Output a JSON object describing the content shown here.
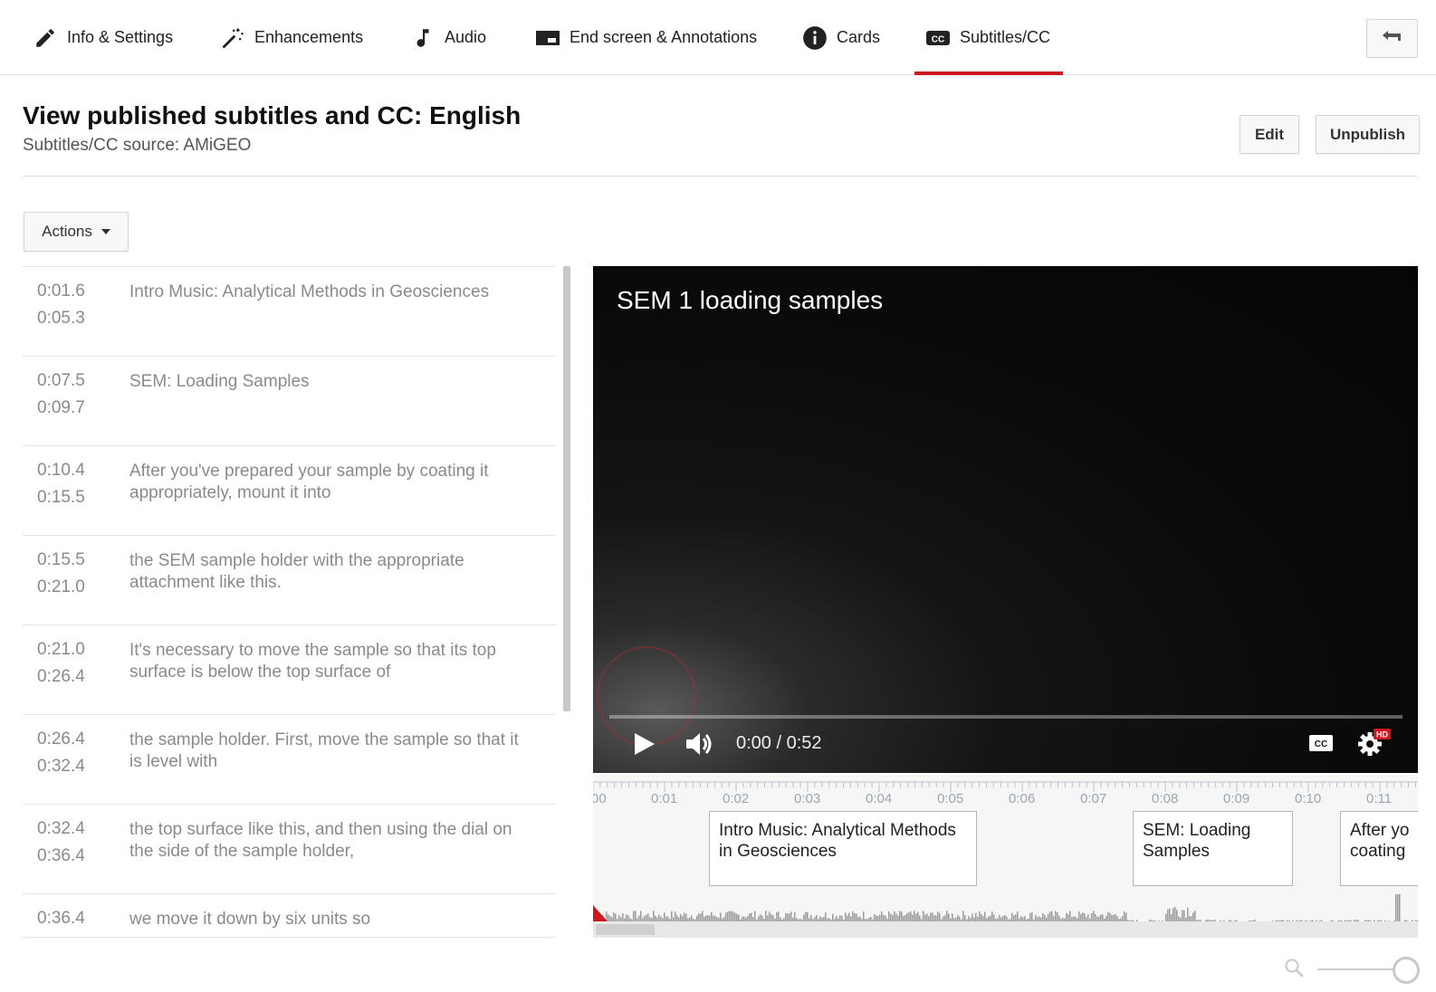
{
  "tabs": [
    {
      "label": "Info & Settings",
      "icon": "pencil-icon"
    },
    {
      "label": "Enhancements",
      "icon": "magic-wand-icon"
    },
    {
      "label": "Audio",
      "icon": "music-note-icon"
    },
    {
      "label": "End screen & Annotations",
      "icon": "end-screen-icon"
    },
    {
      "label": "Cards",
      "icon": "info-circle-icon"
    },
    {
      "label": "Subtitles/CC",
      "icon": "cc-icon",
      "active": true
    }
  ],
  "header": {
    "title": "View published subtitles and CC: English",
    "subtitle": "Subtitles/CC source: AMiGEO",
    "edit_label": "Edit",
    "unpublish_label": "Unpublish"
  },
  "actions_label": "Actions",
  "subtitles": [
    {
      "start": "0:01.6",
      "end": "0:05.3",
      "text": "Intro Music: Analytical Methods in Geosciences"
    },
    {
      "start": "0:07.5",
      "end": "0:09.7",
      "text": "SEM: Loading Samples"
    },
    {
      "start": "0:10.4",
      "end": "0:15.5",
      "text": "After you've prepared your sample by coating it appropriately, mount it into"
    },
    {
      "start": "0:15.5",
      "end": "0:21.0",
      "text": "the SEM sample holder with the appropriate attachment like this."
    },
    {
      "start": "0:21.0",
      "end": "0:26.4",
      "text": "It's necessary to move the sample so that its top surface is below the top surface of"
    },
    {
      "start": "0:26.4",
      "end": "0:32.4",
      "text": "the sample holder. First, move the sample so that it is level with"
    },
    {
      "start": "0:32.4",
      "end": "0:36.4",
      "text": "the top surface like this, and then using the dial on the side of the sample holder,"
    },
    {
      "start": "0:36.4",
      "end": "",
      "text": "we move it down by six units so"
    }
  ],
  "video": {
    "title": "SEM 1 loading samples",
    "time": "0:00 / 0:52",
    "progress": 0,
    "hd_badge": "HD"
  },
  "timeline": {
    "ticks": [
      "00",
      "0:01",
      "0:02",
      "0:03",
      "0:04",
      "0:05",
      "0:06",
      "0:07",
      "0:08",
      "0:09",
      "0:10",
      "0:11"
    ],
    "captions": [
      {
        "text": "Intro Music: Analytical Methods in Geosciences"
      },
      {
        "text": "SEM: Loading Samples"
      },
      {
        "text": "After yo coating"
      }
    ]
  },
  "colors": {
    "accent": "#cc181e",
    "video_bg": "#0b0b0b",
    "muted_text": "#8a8a8a"
  }
}
